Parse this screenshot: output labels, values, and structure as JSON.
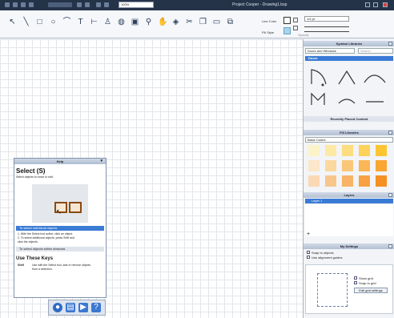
{
  "window": {
    "title": "Project Cooper - Drawing1.bsp",
    "zoom": "100%"
  },
  "tools": [
    {
      "name": "select-arrow-icon",
      "glyph": "↖"
    },
    {
      "name": "line-icon",
      "glyph": "╲"
    },
    {
      "name": "rectangle-icon",
      "glyph": "□"
    },
    {
      "name": "ellipse-icon",
      "glyph": "○"
    },
    {
      "name": "arc-icon",
      "glyph": "⌒"
    },
    {
      "name": "text-icon",
      "glyph": "T"
    },
    {
      "name": "dimension-icon",
      "glyph": "⊢"
    },
    {
      "name": "symbol-icon",
      "glyph": "♙"
    },
    {
      "name": "fill-icon",
      "glyph": "◍"
    },
    {
      "name": "image-icon",
      "glyph": "▣"
    },
    {
      "name": "zoom-icon",
      "glyph": "⚲"
    },
    {
      "name": "pan-hand-icon",
      "glyph": "✋"
    },
    {
      "name": "eraser-icon",
      "glyph": "◈"
    },
    {
      "name": "cut-icon",
      "glyph": "✂"
    },
    {
      "name": "copy-icon",
      "glyph": "❐"
    },
    {
      "name": "comment-icon",
      "glyph": "▭"
    },
    {
      "name": "group-icon",
      "glyph": "⧉"
    }
  ],
  "properties": {
    "line_color_label": "Line Color",
    "fill_style_label": "Fill Style",
    "line_weight": "1/4 pt",
    "opacity_label": "Opacity",
    "colors": {
      "line": "#111111",
      "fill": "#a8d4ee"
    }
  },
  "symbol_libraries": {
    "title": "Symbol Libraries",
    "category": "Doors and Windows",
    "search_placeholder": "Search",
    "section": "Doors"
  },
  "recently_placed": {
    "title": "Recently Placed Content"
  },
  "fill_libraries": {
    "title": "Fill Libraries",
    "category": "Basic Colors",
    "colors": [
      "#fdf3c9",
      "#fde9a6",
      "#fddd7f",
      "#fdd25b",
      "#fcc633",
      "#fbe7c9",
      "#fbd89e",
      "#fac77a",
      "#fab657",
      "#f9a632",
      "#f9d8b3",
      "#f8c68b",
      "#f7b466",
      "#f6a243",
      "#f59022"
    ]
  },
  "layers": {
    "title": "Layers",
    "items": [
      {
        "label": "Layer 1"
      }
    ],
    "add_label": "+"
  },
  "my_settings": {
    "title": "My Settings",
    "snap_objects": "Snap to objects",
    "alignment_guides": "Use alignment guides",
    "show_grid": "Show grid",
    "snap_grid": "Snap to grid",
    "edit_grid_button": "Edit grid settings"
  },
  "help": {
    "header": "Help",
    "title": "Select (S)",
    "subtitle": "Select objects to move or edit.",
    "section1": "To select individual objects",
    "step1": "1. With the Select tool active, click an object.",
    "step2a": "2. To select additional objects, press Shift and",
    "step2b": "click the objects.",
    "section2": "To select objects within windows",
    "keys_title": "Use These Keys",
    "key1_key": "Shift",
    "key1_desc": "Use with the Select tool, add or remove objects",
    "key1_desc2": "from a selection."
  }
}
